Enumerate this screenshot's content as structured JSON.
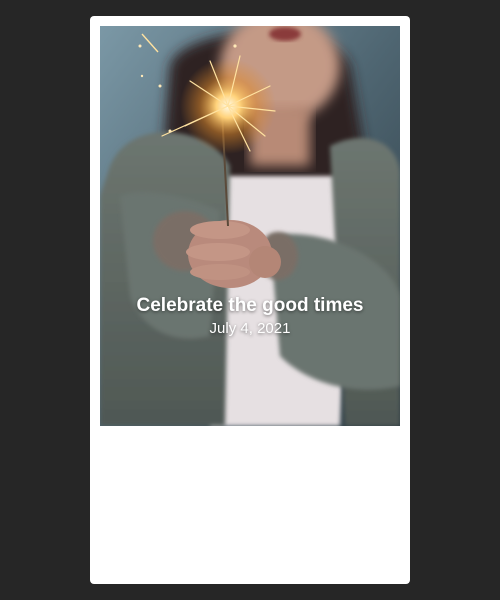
{
  "card": {
    "title": "Celebrate the good times",
    "date": "July 4, 2021",
    "image_subject": "woman-holding-sparkler"
  },
  "colors": {
    "page_background": "#262626",
    "card_background": "#ffffff",
    "caption_text": "#ffffff",
    "sparkler_glow": "#ffd27a"
  }
}
